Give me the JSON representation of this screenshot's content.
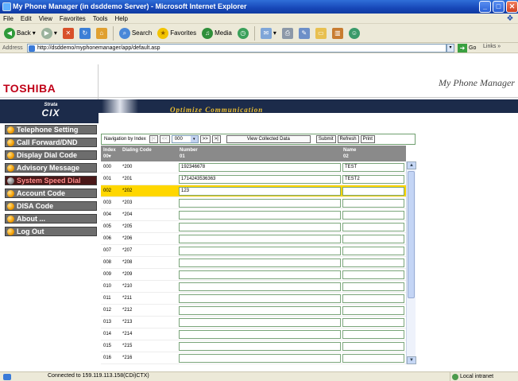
{
  "window": {
    "title": "My Phone Manager (in dsddemo Server) - Microsoft Internet Explorer"
  },
  "menu": [
    "File",
    "Edit",
    "View",
    "Favorites",
    "Tools",
    "Help"
  ],
  "toolbar": {
    "back": "Back",
    "search": "Search",
    "favorites": "Favorites",
    "media": "Media"
  },
  "address": {
    "label": "Address",
    "url": "http://dsddemo/myphonemanager/app/default.asp",
    "go": "Go",
    "links": "Links"
  },
  "brand": {
    "logo": "TOSHIBA",
    "app_name": "My Phone Manager",
    "strata": "Strata",
    "cix": "CIX",
    "slogan": "Optimize Communication"
  },
  "sidebar": {
    "items": [
      {
        "label": "Telephone Setting",
        "active": false
      },
      {
        "label": "Call Forward/DND",
        "active": false
      },
      {
        "label": "Display Dial Code",
        "active": false
      },
      {
        "label": "Advisory Message",
        "active": false
      },
      {
        "label": "System Speed Dial",
        "active": true
      },
      {
        "label": "Account Code",
        "active": false
      },
      {
        "label": "DISA Code",
        "active": false
      },
      {
        "label": "About ...",
        "active": false
      },
      {
        "label": "Log Out",
        "active": false
      }
    ]
  },
  "nav": {
    "navigate_label": "Navigation by Index",
    "first": "|<",
    "prev": "<<",
    "index_value": "000",
    "next": ">>",
    "last": ">|",
    "view_collected": "View Collected Data",
    "submit": "Submit",
    "refresh": "Refresh",
    "print": "Print"
  },
  "table": {
    "headers": [
      {
        "line1": "Index",
        "line2": "00▾"
      },
      {
        "line1": "Dialing Code",
        "line2": ""
      },
      {
        "line1": "Number",
        "line2": "01"
      },
      {
        "line1": "Name",
        "line2": "02"
      }
    ],
    "rows": [
      {
        "index": "000",
        "code": "*200",
        "number": "192346678",
        "name": "TEST"
      },
      {
        "index": "001",
        "code": "*201",
        "number": "1714243536363",
        "name": "TEST2"
      },
      {
        "index": "002",
        "code": "*202",
        "number": "123",
        "name": "",
        "highlight": true
      },
      {
        "index": "003",
        "code": "*203",
        "number": "",
        "name": ""
      },
      {
        "index": "004",
        "code": "*204",
        "number": "",
        "name": ""
      },
      {
        "index": "005",
        "code": "*205",
        "number": "",
        "name": ""
      },
      {
        "index": "006",
        "code": "*206",
        "number": "",
        "name": ""
      },
      {
        "index": "007",
        "code": "*207",
        "number": "",
        "name": ""
      },
      {
        "index": "008",
        "code": "*208",
        "number": "",
        "name": ""
      },
      {
        "index": "009",
        "code": "*209",
        "number": "",
        "name": ""
      },
      {
        "index": "010",
        "code": "*210",
        "number": "",
        "name": ""
      },
      {
        "index": "011",
        "code": "*211",
        "number": "",
        "name": ""
      },
      {
        "index": "012",
        "code": "*212",
        "number": "",
        "name": ""
      },
      {
        "index": "013",
        "code": "*213",
        "number": "",
        "name": ""
      },
      {
        "index": "014",
        "code": "*214",
        "number": "",
        "name": ""
      },
      {
        "index": "015",
        "code": "*215",
        "number": "",
        "name": ""
      },
      {
        "index": "016",
        "code": "*216",
        "number": "",
        "name": ""
      }
    ]
  },
  "status": {
    "message": "Connected to 159.119.113.158(CDi)CTX)",
    "zone": "Local intranet"
  },
  "colors": {
    "highlight_row": "#ffd700",
    "banner": "#1c2b4a",
    "logo_red": "#c00018"
  }
}
